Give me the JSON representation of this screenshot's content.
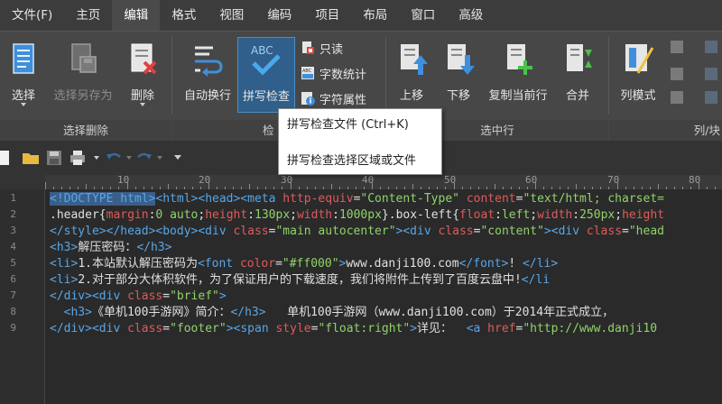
{
  "menu": [
    "文件(F)",
    "主页",
    "编辑",
    "格式",
    "视图",
    "编码",
    "项目",
    "布局",
    "窗口",
    "高级"
  ],
  "ribbon": {
    "select": "选择",
    "select_save_as": "选择另存为",
    "delete": "删除",
    "group_select_delete": "选择删除",
    "auto_wrap": "自动换行",
    "spell_check": "拼写检查",
    "readonly": "只读",
    "word_count": "字数统计",
    "char_props": "字符属性",
    "group_check": "检",
    "move_up": "上移",
    "move_down": "下移",
    "copy_current_line": "复制当前行",
    "merge": "合并",
    "group_selected_lines": "选中行",
    "column_mode": "列模式",
    "group_column": "列/块"
  },
  "tooltip": {
    "line1": "拼写检查文件 (Ctrl+K)",
    "line2": "拼写检查选择区域或文件"
  },
  "ruler_numbers": [
    "10",
    "20",
    "30",
    "40",
    "50",
    "60",
    "70",
    "80"
  ],
  "line_numbers": [
    "1",
    "2",
    "3",
    "4",
    "5",
    "6",
    "7",
    "8",
    "9"
  ],
  "code": {
    "l1": [
      {
        "c": "tag hl",
        "t": "<!DOCTYPE html>"
      },
      {
        "c": "tag",
        "t": "<html><head><meta "
      },
      {
        "c": "attr",
        "t": "http-equiv"
      },
      {
        "c": "",
        "t": "="
      },
      {
        "c": "val",
        "t": "\"Content-Type\""
      },
      {
        "c": "",
        "t": " "
      },
      {
        "c": "attr",
        "t": "content"
      },
      {
        "c": "",
        "t": "="
      },
      {
        "c": "val",
        "t": "\"text/html; charset="
      }
    ],
    "l2": [
      {
        "c": "",
        "t": ".header{"
      },
      {
        "c": "attr",
        "t": "margin"
      },
      {
        "c": "",
        "t": ":"
      },
      {
        "c": "val",
        "t": "0 auto"
      },
      {
        "c": "",
        "t": ";"
      },
      {
        "c": "attr",
        "t": "height"
      },
      {
        "c": "",
        "t": ":"
      },
      {
        "c": "val",
        "t": "130px"
      },
      {
        "c": "",
        "t": ";"
      },
      {
        "c": "attr",
        "t": "width"
      },
      {
        "c": "",
        "t": ":"
      },
      {
        "c": "val",
        "t": "1000px"
      },
      {
        "c": "",
        "t": "}.box-left{"
      },
      {
        "c": "attr",
        "t": "float"
      },
      {
        "c": "",
        "t": ":"
      },
      {
        "c": "val",
        "t": "left"
      },
      {
        "c": "",
        "t": ";"
      },
      {
        "c": "attr",
        "t": "width"
      },
      {
        "c": "",
        "t": ":"
      },
      {
        "c": "val",
        "t": "250px"
      },
      {
        "c": "",
        "t": ";"
      },
      {
        "c": "attr",
        "t": "height"
      }
    ],
    "l3": [
      {
        "c": "tag",
        "t": "</style></head><body><div "
      },
      {
        "c": "attr",
        "t": "class"
      },
      {
        "c": "",
        "t": "="
      },
      {
        "c": "val",
        "t": "\"main autocenter\""
      },
      {
        "c": "tag",
        "t": "><div "
      },
      {
        "c": "attr",
        "t": "class"
      },
      {
        "c": "",
        "t": "="
      },
      {
        "c": "val",
        "t": "\"content\""
      },
      {
        "c": "tag",
        "t": "><div "
      },
      {
        "c": "attr",
        "t": "class"
      },
      {
        "c": "",
        "t": "="
      },
      {
        "c": "val",
        "t": "\"head"
      }
    ],
    "l4": [
      {
        "c": "tag",
        "t": "<h3>"
      },
      {
        "c": "",
        "t": "解压密码："
      },
      {
        "c": "tag",
        "t": "</h3>"
      }
    ],
    "l5": [
      {
        "c": "tag",
        "t": "<li>"
      },
      {
        "c": "",
        "t": "1.本站默认解压密码为"
      },
      {
        "c": "tag",
        "t": "<font "
      },
      {
        "c": "attr",
        "t": "color"
      },
      {
        "c": "",
        "t": "="
      },
      {
        "c": "val",
        "t": "\"#ff000\""
      },
      {
        "c": "tag",
        "t": ">"
      },
      {
        "c": "",
        "t": "www.danji100.com"
      },
      {
        "c": "tag",
        "t": "</font>"
      },
      {
        "c": "",
        "t": "! "
      },
      {
        "c": "tag",
        "t": "</li>"
      }
    ],
    "l6": [
      {
        "c": "tag",
        "t": "<li>"
      },
      {
        "c": "",
        "t": "2.对于部分大体积软件，为了保证用户的下载速度，我们将附件上传到了百度云盘中!"
      },
      {
        "c": "tag",
        "t": "</li"
      }
    ],
    "l7": [
      {
        "c": "tag",
        "t": "</div><div "
      },
      {
        "c": "attr",
        "t": "class"
      },
      {
        "c": "",
        "t": "="
      },
      {
        "c": "val",
        "t": "\"brief\""
      },
      {
        "c": "tag",
        "t": ">"
      }
    ],
    "l8": [
      {
        "c": "",
        "t": "  "
      },
      {
        "c": "tag",
        "t": "<h3>"
      },
      {
        "c": "",
        "t": "《单机100手游网》简介："
      },
      {
        "c": "tag",
        "t": "</h3>"
      },
      {
        "c": "",
        "t": "   单机100手游网（www.danji100.com）于2014年正式成立，"
      }
    ],
    "l9": [
      {
        "c": "tag",
        "t": "</div><div "
      },
      {
        "c": "attr",
        "t": "class"
      },
      {
        "c": "",
        "t": "="
      },
      {
        "c": "val",
        "t": "\"footer\""
      },
      {
        "c": "tag",
        "t": "><span "
      },
      {
        "c": "attr",
        "t": "style"
      },
      {
        "c": "",
        "t": "="
      },
      {
        "c": "val",
        "t": "\"float:right\""
      },
      {
        "c": "tag",
        "t": ">"
      },
      {
        "c": "",
        "t": "详见：  "
      },
      {
        "c": "tag",
        "t": "<a "
      },
      {
        "c": "attr",
        "t": "href"
      },
      {
        "c": "",
        "t": "="
      },
      {
        "c": "val",
        "t": "\"http://www.danji10"
      }
    ]
  },
  "colors": {
    "tag": "#57a6e8",
    "attribute": "#e05a5a",
    "value": "#8fd46a",
    "accent": "#2f5f8a"
  }
}
